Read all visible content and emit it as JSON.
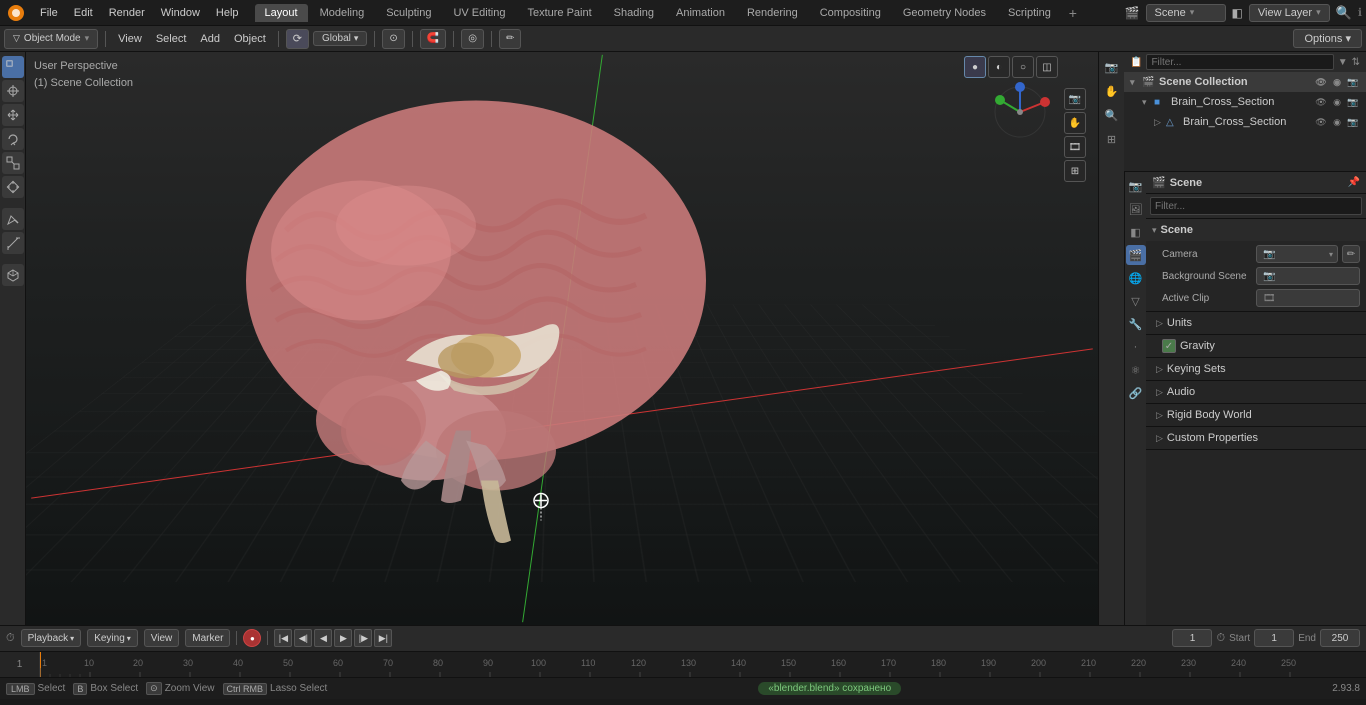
{
  "app": {
    "version": "2.93.8"
  },
  "menu": {
    "items": [
      "File",
      "Edit",
      "Render",
      "Window",
      "Help"
    ],
    "logo": "⬡"
  },
  "workspaces": {
    "tabs": [
      "Layout",
      "Modeling",
      "Sculpting",
      "UV Editing",
      "Texture Paint",
      "Shading",
      "Animation",
      "Rendering",
      "Compositing",
      "Geometry Nodes",
      "Scripting"
    ],
    "active": "Layout",
    "plus": "+"
  },
  "scene": {
    "name": "Scene",
    "viewlayer": "View Layer"
  },
  "header_bar": {
    "mode": "Object Mode",
    "view_label": "View",
    "select_label": "Select",
    "add_label": "Add",
    "object_label": "Object",
    "transform_global": "Global",
    "options_label": "Options ▾"
  },
  "viewport": {
    "perspective": "User Perspective",
    "collection": "(1) Scene Collection"
  },
  "outliner": {
    "title": "Scene Collection",
    "search_placeholder": "Filter...",
    "items": [
      {
        "name": "Brain_Cross_Section",
        "indent": 0,
        "expanded": true,
        "icon": "▷",
        "type": "collection"
      },
      {
        "name": "Brain_Cross_Section",
        "indent": 1,
        "expanded": false,
        "icon": "▷",
        "type": "mesh"
      }
    ]
  },
  "properties": {
    "icon": "🎬",
    "title": "Scene",
    "scene_section": {
      "title": "Scene",
      "expanded": true,
      "camera_label": "Camera",
      "camera_value": "",
      "background_scene_label": "Background Scene",
      "background_scene_value": "",
      "active_clip_label": "Active Clip",
      "active_clip_value": ""
    },
    "units_label": "Units",
    "gravity_label": "Gravity",
    "gravity_checked": true,
    "keying_sets_label": "Keying Sets",
    "audio_label": "Audio",
    "rigid_body_world_label": "Rigid Body World",
    "custom_properties_label": "Custom Properties"
  },
  "timeline": {
    "playback_label": "Playback",
    "keying_label": "Keying",
    "view_label": "View",
    "marker_label": "Marker",
    "current_frame": "1",
    "fps_icon": "⏱",
    "start_label": "Start",
    "start_value": "1",
    "end_label": "End",
    "end_value": "250",
    "ruler_marks": [
      "1",
      "10",
      "20",
      "30",
      "40",
      "50",
      "60",
      "70",
      "80",
      "90",
      "100",
      "110",
      "120",
      "130",
      "140",
      "150",
      "160",
      "170",
      "180",
      "190",
      "200",
      "210",
      "220",
      "230",
      "240",
      "250"
    ]
  },
  "status_bar": {
    "select_label": "Select",
    "box_select_label": "Box Select",
    "zoom_view_label": "Zoom View",
    "lasso_select_label": "Lasso Select",
    "saved_message": "«blender.blend» сохранено",
    "version": "2.93.8"
  },
  "props_icons": [
    {
      "id": "render-icon",
      "symbol": "📷",
      "active": false
    },
    {
      "id": "output-icon",
      "symbol": "🖼",
      "active": false
    },
    {
      "id": "view-layer-icon",
      "symbol": "◧",
      "active": false
    },
    {
      "id": "scene-icon",
      "symbol": "🎬",
      "active": true
    },
    {
      "id": "world-icon",
      "symbol": "🌐",
      "active": false
    },
    {
      "id": "object-icon",
      "symbol": "▽",
      "active": false
    },
    {
      "id": "modifier-icon",
      "symbol": "🔧",
      "active": false
    },
    {
      "id": "particles-icon",
      "symbol": "·",
      "active": false
    },
    {
      "id": "physics-icon",
      "symbol": "⚛",
      "active": false
    },
    {
      "id": "constraints-icon",
      "symbol": "🔗",
      "active": false
    }
  ]
}
